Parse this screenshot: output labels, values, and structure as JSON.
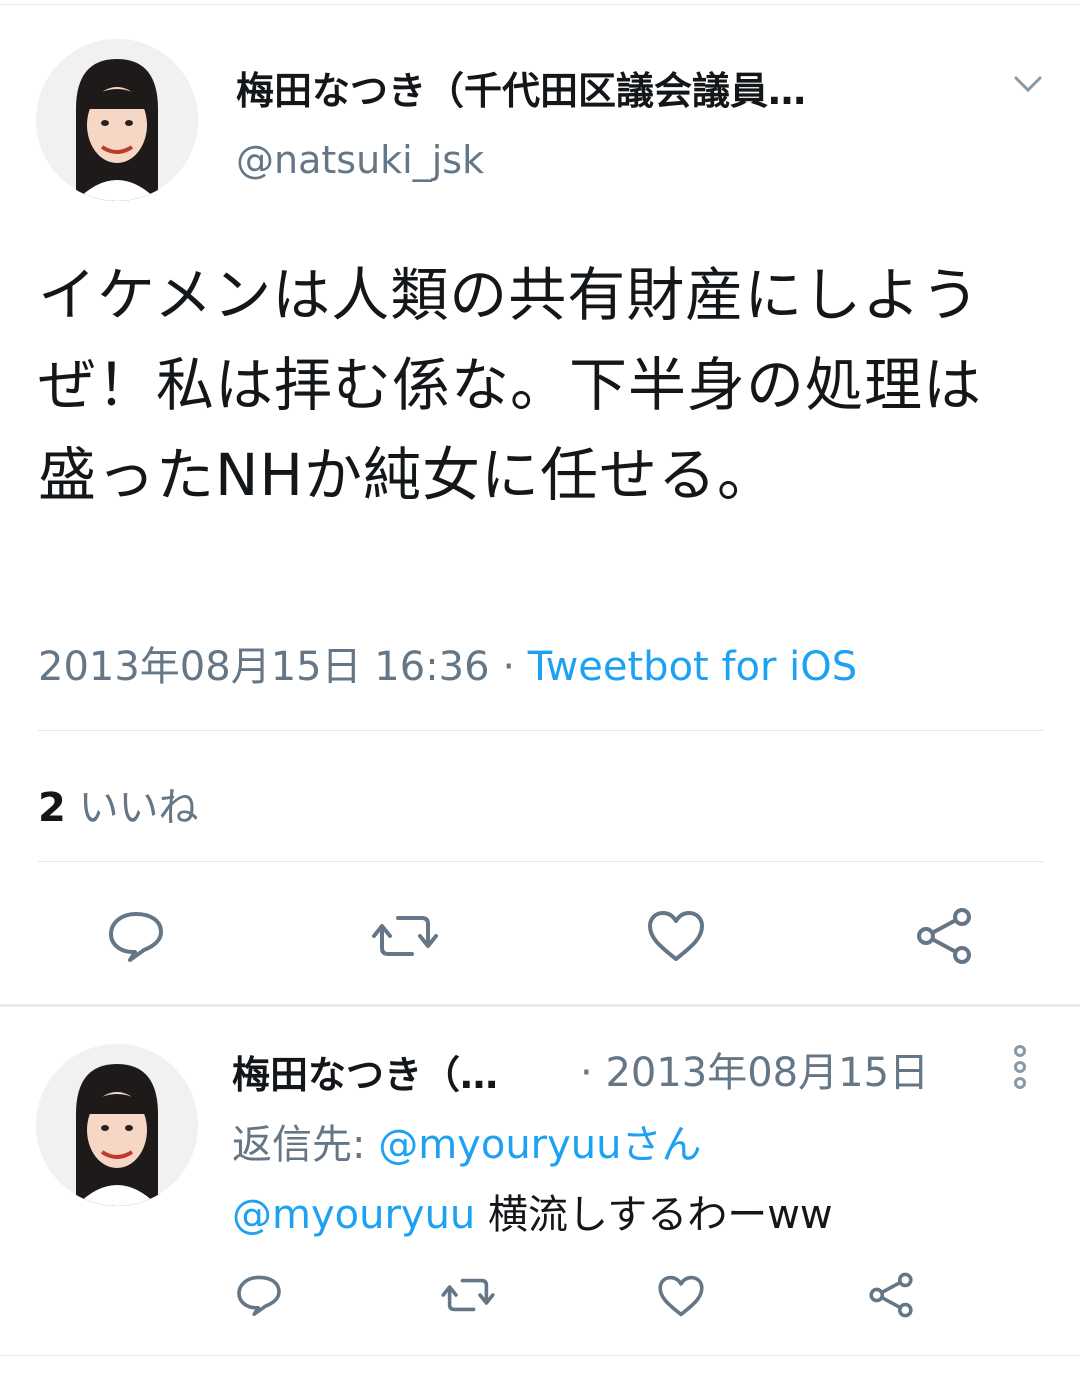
{
  "tweet": {
    "author": {
      "display_name": "梅田なつき（千代田区議会議員…",
      "handle": "@natsuki_jsk",
      "avatar_icon": "profile-photo-icon"
    },
    "text": "イケメンは人類の共有財産にしようぜ！私は拝む係な。下半身の処理は盛ったNHか純女に任せる。",
    "timestamp": "2013年08月15日 16:36",
    "separator": "·",
    "source": "Tweetbot for iOS",
    "likes": {
      "count": "2",
      "label": "いいね"
    },
    "actions": [
      "reply-icon",
      "retweet-icon",
      "like-icon",
      "share-icon"
    ]
  },
  "reply": {
    "author": {
      "display_name": "梅田なつき（…",
      "avatar_icon": "profile-photo-icon"
    },
    "date_prefix": "·",
    "date": "2013年08月15日",
    "reply_to_label": "返信先:",
    "reply_to_user": "@myouryuuさん",
    "mention": "@myouryuu",
    "text": "横流しするわーww",
    "actions": [
      "reply-icon",
      "retweet-icon",
      "like-icon",
      "share-icon"
    ]
  },
  "colors": {
    "link": "#1da1f2",
    "muted": "#657786",
    "text": "#14171a",
    "divider": "#e6ecf0"
  }
}
